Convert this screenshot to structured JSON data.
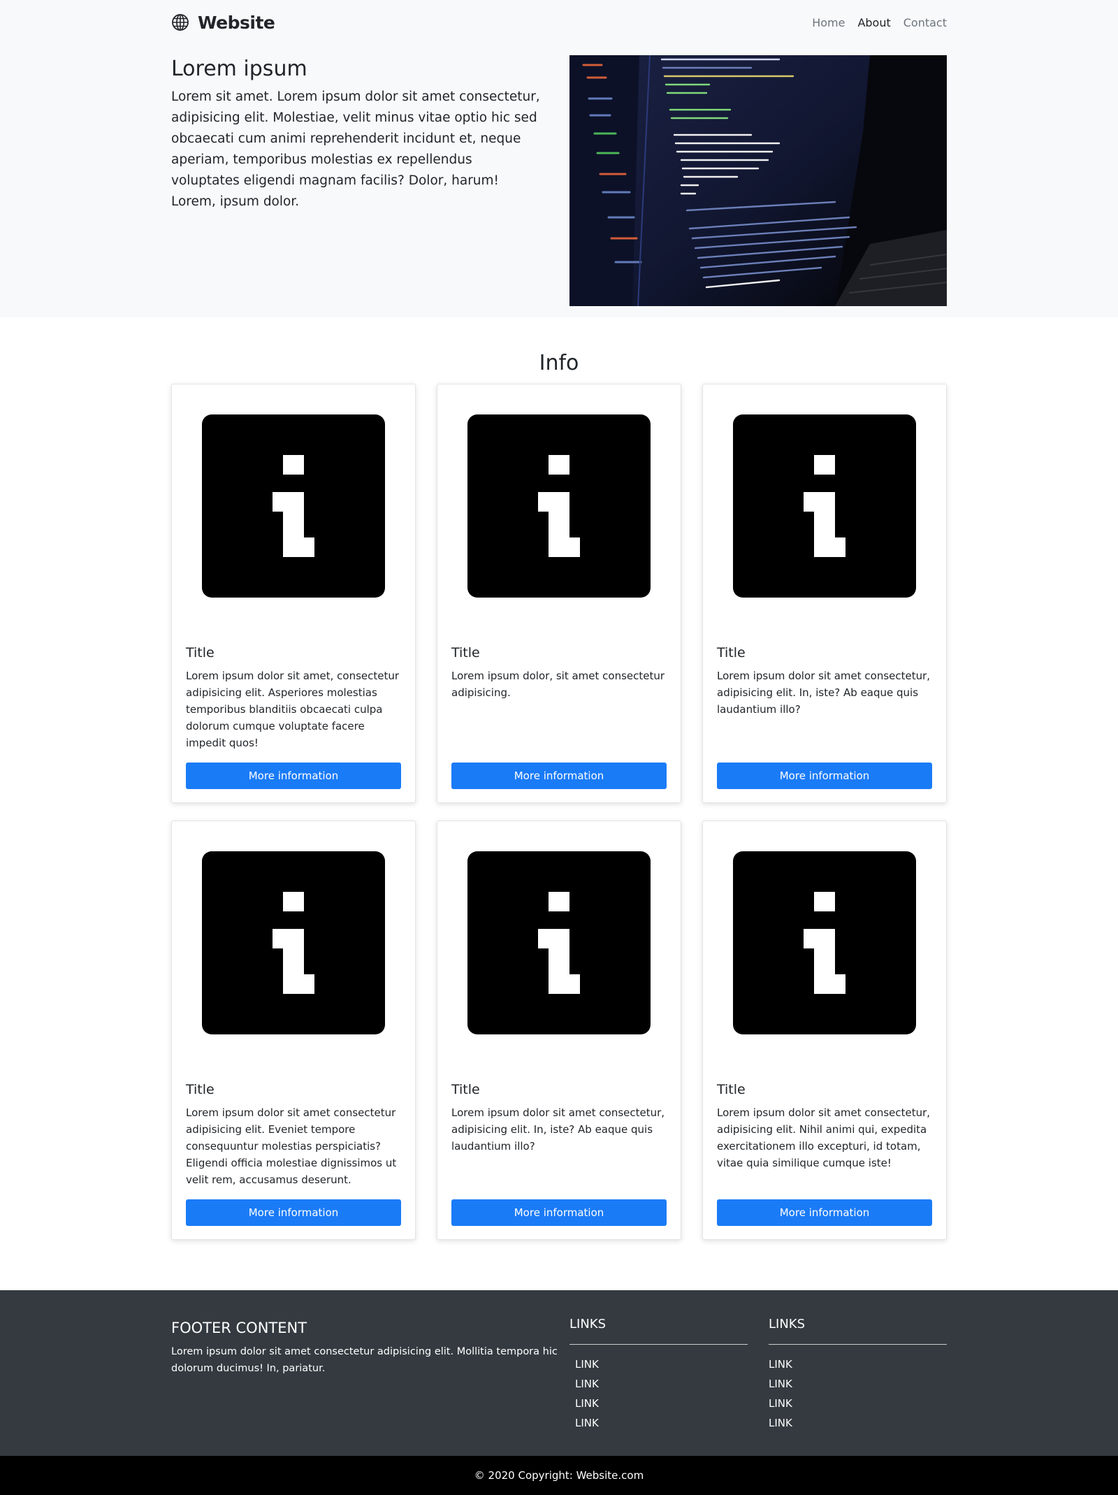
{
  "navbar": {
    "brand": "Website",
    "brand_icon": "globe-icon",
    "links": [
      {
        "label": "Home",
        "active": false
      },
      {
        "label": "About",
        "active": true
      },
      {
        "label": "Contact",
        "active": false
      }
    ]
  },
  "hero": {
    "title": "Lorem ipsum",
    "description": "Lorem sit amet. Lorem ipsum dolor sit amet consectetur, adipisicing elit. Molestiae, velit minus vitae optio hic sed obcaecati cum animi reprehenderit incidunt et, neque aperiam, temporibus molestias ex repellendus voluptates eligendi magnam facilis? Dolor, harum! Lorem, ipsum dolor.",
    "image_icon": "code-screen-photo"
  },
  "info": {
    "title": "Info",
    "cards": [
      {
        "icon": "info-icon",
        "title": "Title",
        "text": "Lorem ipsum dolor sit amet, consectetur adipisicing elit. Asperiores molestias temporibus blanditiis obcaecati culpa dolorum cumque voluptate facere impedit quos!",
        "button": "More information"
      },
      {
        "icon": "info-icon",
        "title": "Title",
        "text": "Lorem ipsum dolor, sit amet consectetur adipisicing.",
        "button": "More information"
      },
      {
        "icon": "info-icon",
        "title": "Title",
        "text": "Lorem ipsum dolor sit amet consectetur, adipisicing elit. In, iste? Ab eaque quis laudantium illo?",
        "button": "More information"
      },
      {
        "icon": "info-icon",
        "title": "Title",
        "text": "Lorem ipsum dolor sit amet consectetur adipisicing elit. Eveniet tempore consequuntur molestias perspiciatis? Eligendi officia molestiae dignissimos ut velit rem, accusamus deserunt.",
        "button": "More information"
      },
      {
        "icon": "info-icon",
        "title": "Title",
        "text": "Lorem ipsum dolor sit amet consectetur, adipisicing elit. In, iste? Ab eaque quis laudantium illo?",
        "button": "More information"
      },
      {
        "icon": "info-icon",
        "title": "Title",
        "text": "Lorem ipsum dolor sit amet consectetur, adipisicing elit. Nihil animi qui, expedita exercitationem illo excepturi, id totam, vitae quia similique cumque iste!",
        "button": "More information"
      }
    ]
  },
  "footer": {
    "title": "Footer Content",
    "text": "Lorem ipsum dolor sit amet consectetur adipisicing elit. Mollitia tempora hic dolorum ducimus! In, pariatur.",
    "columns": [
      {
        "title": "Links",
        "links": [
          "LINK",
          "LINK",
          "LINK",
          "LINK"
        ]
      },
      {
        "title": "Links",
        "links": [
          "LINK",
          "LINK",
          "LINK",
          "LINK"
        ]
      }
    ],
    "copyright": "© 2020 Copyright: Website.com"
  },
  "colors": {
    "accent": "#1a7bf7",
    "hero_bg": "#f8f9fa",
    "footer_bg": "#343a40",
    "copyright_bg": "#000000"
  }
}
